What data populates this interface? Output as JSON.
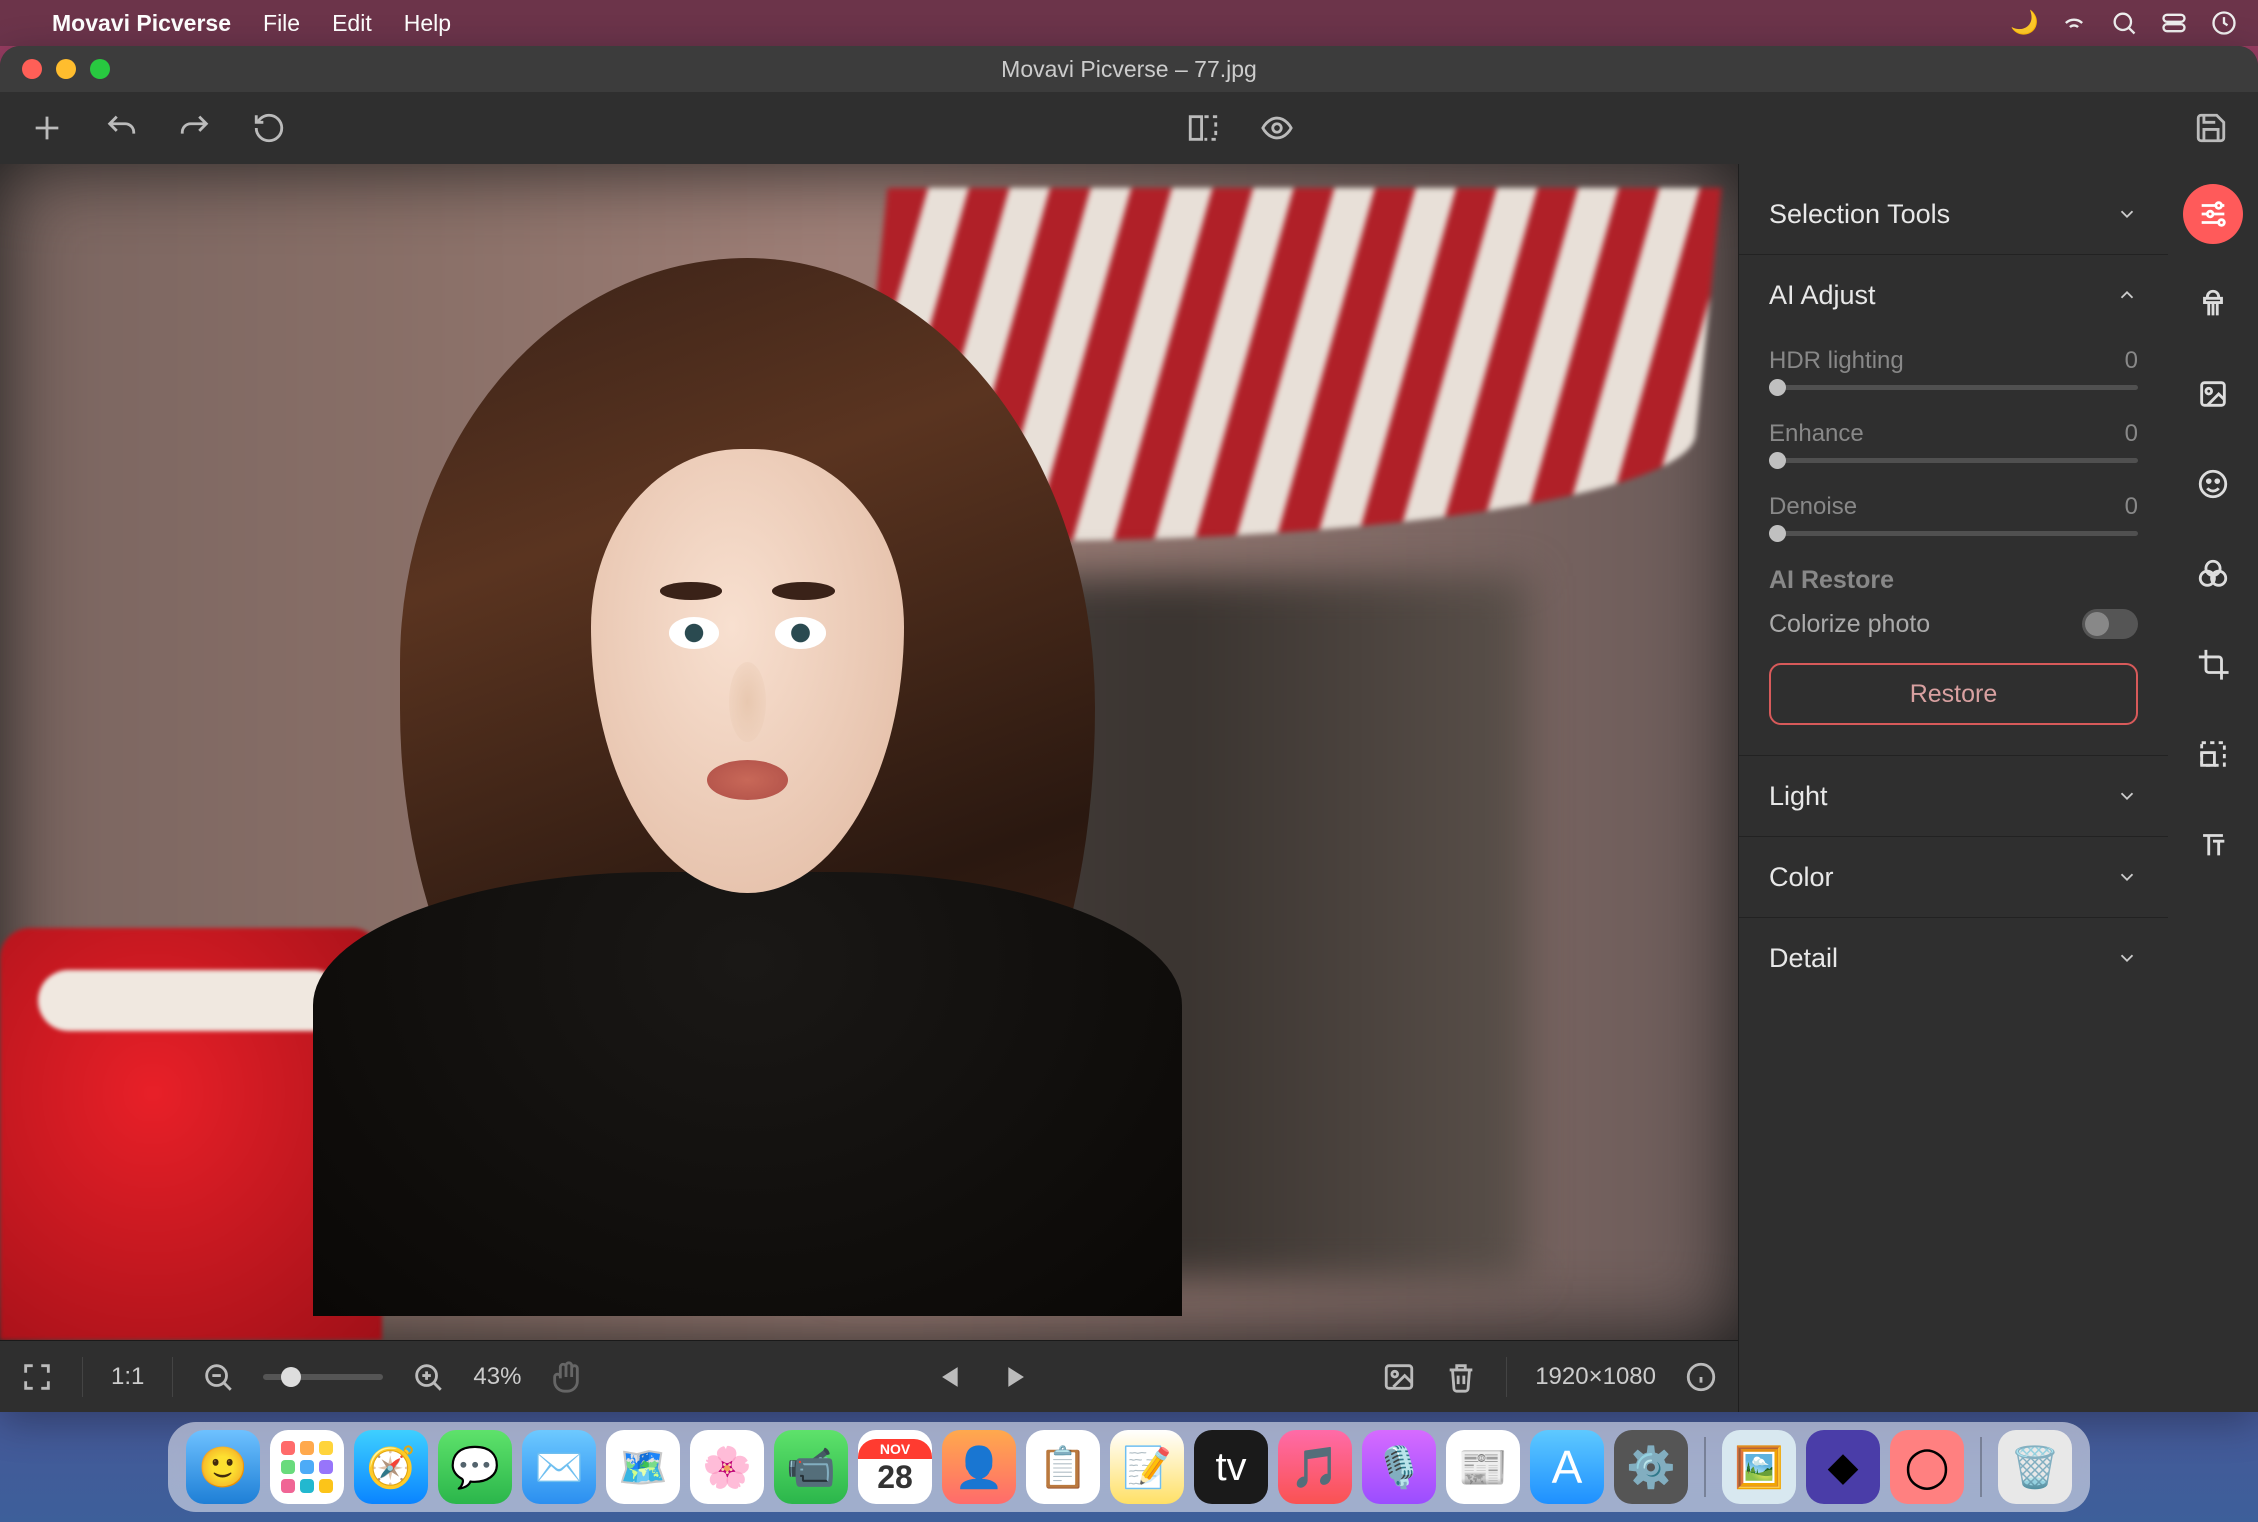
{
  "menubar": {
    "app_name": "Movavi Picverse",
    "items": [
      "File",
      "Edit",
      "Help"
    ]
  },
  "window": {
    "title": "Movavi Picverse – 77.jpg"
  },
  "statusbar": {
    "ratio": "1:1",
    "zoom_percent": "43%",
    "dimensions": "1920×1080"
  },
  "side_panel": {
    "sections": {
      "selection_tools": "Selection Tools",
      "ai_adjust": {
        "title": "AI Adjust",
        "sliders": [
          {
            "label": "HDR lighting",
            "value": "0"
          },
          {
            "label": "Enhance",
            "value": "0"
          },
          {
            "label": "Denoise",
            "value": "0"
          }
        ],
        "ai_restore_title": "AI Restore",
        "colorize_label": "Colorize photo",
        "restore_button": "Restore"
      },
      "light": "Light",
      "color": "Color",
      "detail": "Detail"
    }
  },
  "right_tools": [
    "adjust",
    "retouch",
    "effects",
    "face",
    "filters",
    "crop",
    "resize",
    "text"
  ],
  "dock_date": {
    "day": "NOV",
    "num": "28"
  }
}
